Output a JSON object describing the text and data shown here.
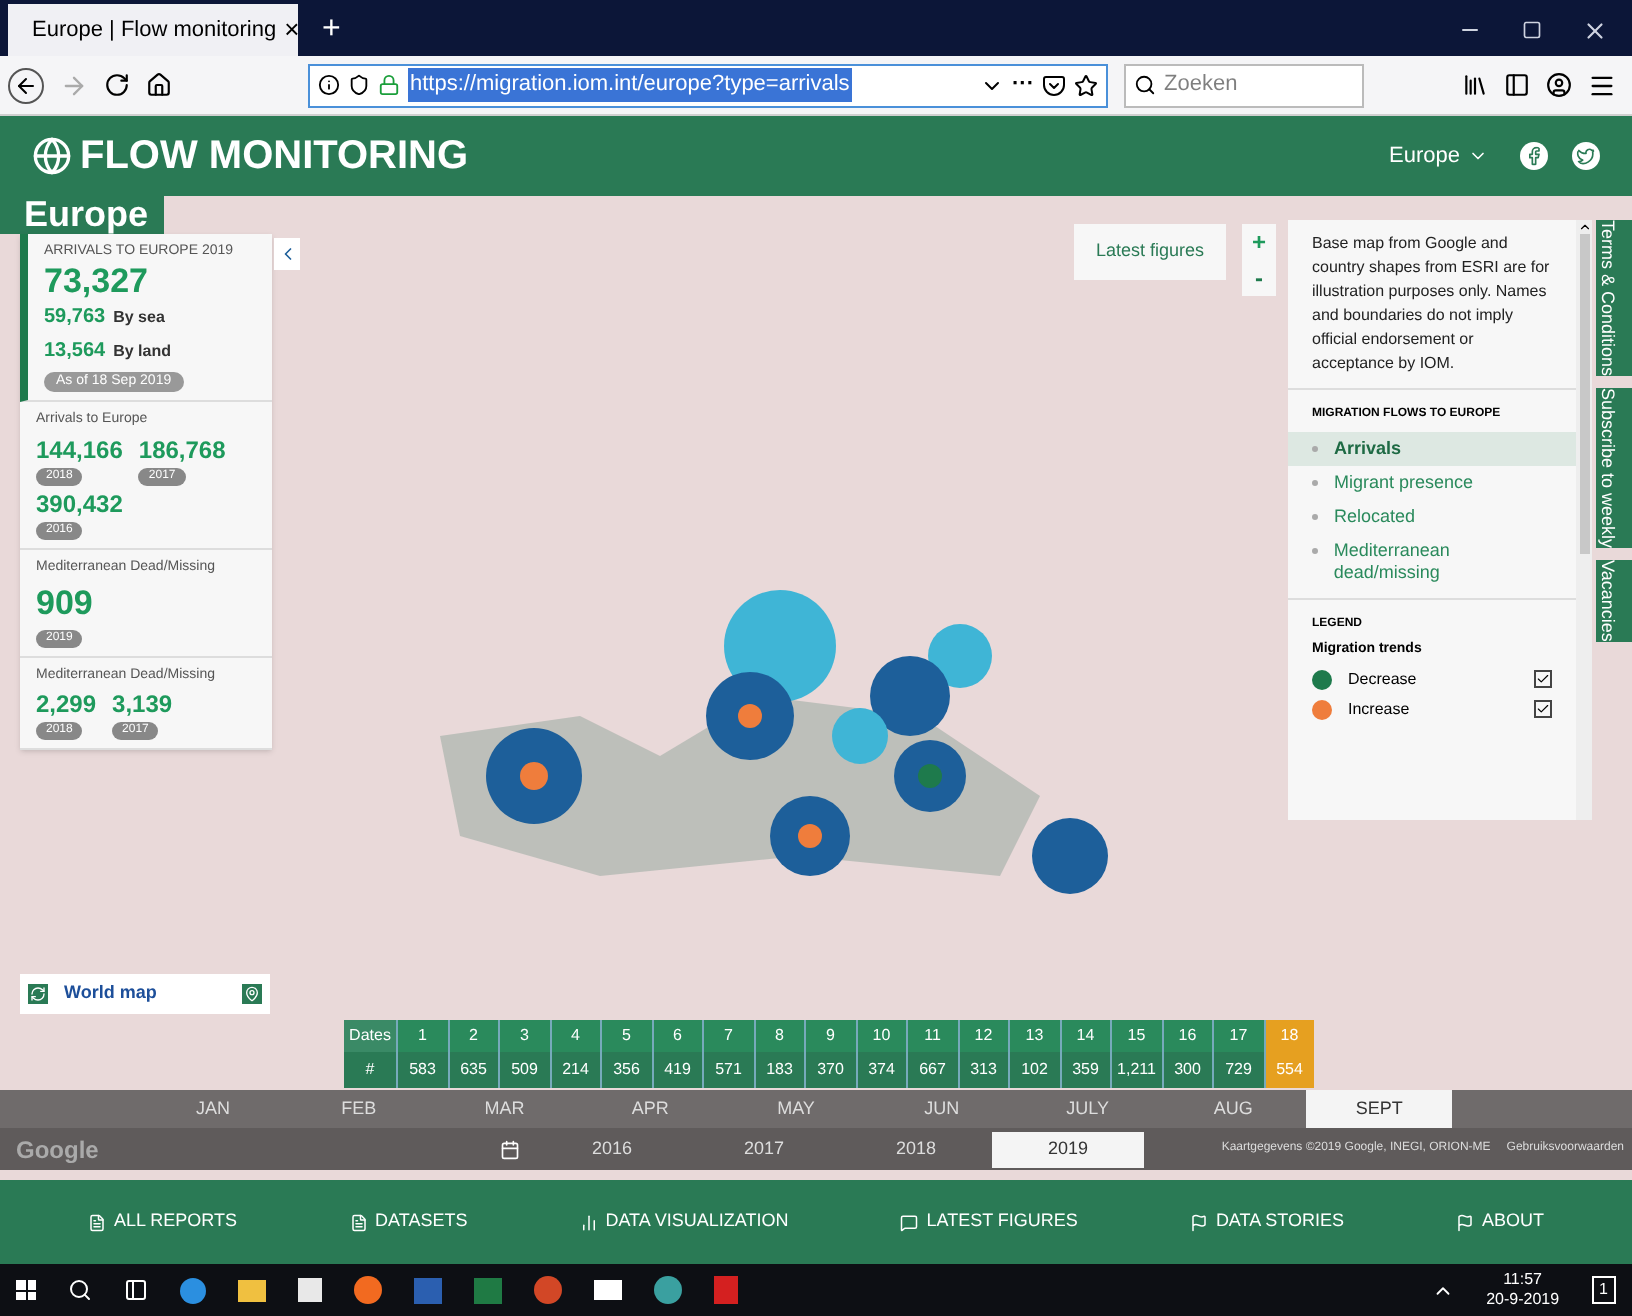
{
  "browser": {
    "tab_title": "Europe | Flow monitoring",
    "new_tab": "+",
    "close_tab": "×",
    "url": "https://migration.iom.int/europe?type=arrivals",
    "menu_dots": "···",
    "search_placeholder": "Zoeken"
  },
  "header": {
    "logo_text": "FLOW MONITORING",
    "region": "Europe"
  },
  "page_title": "Europe",
  "stats": [
    {
      "kind": "main",
      "title": "ARRIVALS TO EUROPE 2019",
      "value": "73,327",
      "sub": [
        {
          "value": "59,763",
          "label": "By sea"
        },
        {
          "value": "13,564",
          "label": "By land"
        }
      ],
      "badge": "As of 18 Sep 2019"
    },
    {
      "kind": "years",
      "title": "Arrivals to Europe",
      "items": [
        {
          "value": "144,166",
          "year": "2018"
        },
        {
          "value": "186,768",
          "year": "2017"
        },
        {
          "value": "390,432",
          "year": "2016"
        }
      ]
    },
    {
      "kind": "years",
      "title": "Mediterranean Dead/Missing",
      "items": [
        {
          "value": "909",
          "year": "2019"
        }
      ]
    },
    {
      "kind": "years",
      "title": "Mediterranean Dead/Missing",
      "items": [
        {
          "value": "2,299",
          "year": "2018"
        },
        {
          "value": "3,139",
          "year": "2017"
        }
      ]
    }
  ],
  "world_map": "World map",
  "latest_figures": "Latest figures",
  "zoom": {
    "in": "+",
    "out": "-"
  },
  "disclaimer": "Base map from Google and country shapes from ESRI are for illustration purposes only. Names and boundaries do not imply official endorsement or acceptance by IOM.",
  "flows": {
    "title": "MIGRATION FLOWS TO EUROPE",
    "items": [
      {
        "label": "Arrivals",
        "selected": true
      },
      {
        "label": "Migrant presence",
        "selected": false
      },
      {
        "label": "Relocated",
        "selected": false
      },
      {
        "label": "Mediterranean dead/missing",
        "selected": false
      }
    ]
  },
  "legend": {
    "title": "LEGEND",
    "subtitle": "Migration trends",
    "items": [
      {
        "label": "Decrease",
        "color": "#1e7a4c",
        "checked": true
      },
      {
        "label": "Increase",
        "color": "#ef7d3c",
        "checked": true
      }
    ]
  },
  "side_tabs": [
    "Terms & Conditions",
    "Subscribe to weekly",
    "Vacancies"
  ],
  "timeline": {
    "dates_label": "Dates",
    "count_label": "#",
    "days": [
      {
        "day": "1",
        "count": "583",
        "selected": false
      },
      {
        "day": "2",
        "count": "635",
        "selected": false
      },
      {
        "day": "3",
        "count": "509",
        "selected": false
      },
      {
        "day": "4",
        "count": "214",
        "selected": false
      },
      {
        "day": "5",
        "count": "356",
        "selected": false
      },
      {
        "day": "6",
        "count": "419",
        "selected": false
      },
      {
        "day": "7",
        "count": "571",
        "selected": false
      },
      {
        "day": "8",
        "count": "183",
        "selected": false
      },
      {
        "day": "9",
        "count": "370",
        "selected": false
      },
      {
        "day": "10",
        "count": "374",
        "selected": false
      },
      {
        "day": "11",
        "count": "667",
        "selected": false
      },
      {
        "day": "12",
        "count": "313",
        "selected": false
      },
      {
        "day": "13",
        "count": "102",
        "selected": false
      },
      {
        "day": "14",
        "count": "359",
        "selected": false
      },
      {
        "day": "15",
        "count": "1,211",
        "selected": false
      },
      {
        "day": "16",
        "count": "300",
        "selected": false
      },
      {
        "day": "17",
        "count": "729",
        "selected": false
      },
      {
        "day": "18",
        "count": "554",
        "selected": true
      }
    ],
    "months": [
      {
        "label": "JAN",
        "selected": false
      },
      {
        "label": "FEB",
        "selected": false
      },
      {
        "label": "MAR",
        "selected": false
      },
      {
        "label": "APR",
        "selected": false
      },
      {
        "label": "MAY",
        "selected": false
      },
      {
        "label": "JUN",
        "selected": false
      },
      {
        "label": "JULY",
        "selected": false
      },
      {
        "label": "AUG",
        "selected": false
      },
      {
        "label": "SEPT",
        "selected": true
      }
    ],
    "years": [
      {
        "label": "2016",
        "selected": false
      },
      {
        "label": "2017",
        "selected": false
      },
      {
        "label": "2018",
        "selected": false
      },
      {
        "label": "2019",
        "selected": true
      }
    ]
  },
  "map_logo": "Google",
  "map_attribution": "Kaartgegevens ©2019 Google, INEGI, ORION-ME",
  "map_terms": "Gebruiksvoorwaarden",
  "footer": [
    "ALL REPORTS",
    "DATASETS",
    "DATA VISUALIZATION",
    "LATEST FIGURES",
    "DATA STORIES",
    "ABOUT"
  ],
  "taskbar": {
    "time": "11:57",
    "date": "20-9-2019",
    "notifications": "1"
  }
}
